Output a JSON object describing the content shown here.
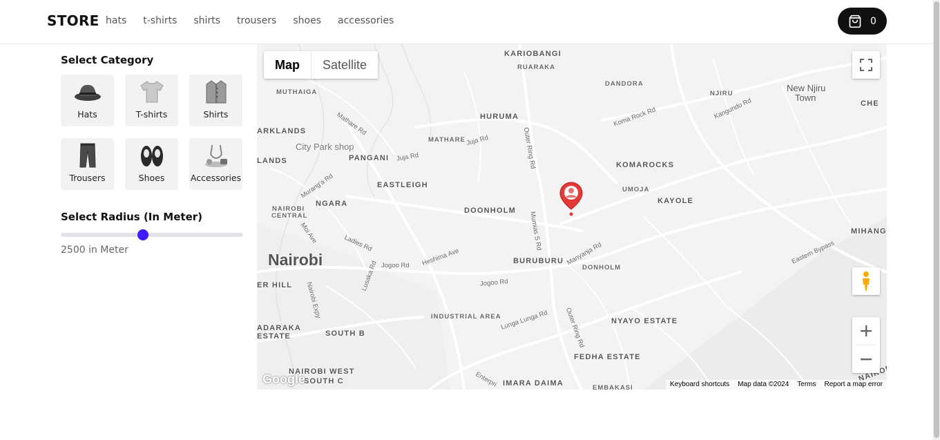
{
  "header": {
    "brand": "STORE",
    "nav": [
      "hats",
      "t-shirts",
      "shirts",
      "trousers",
      "shoes",
      "accessories"
    ],
    "cart_count": "0"
  },
  "sidebar": {
    "category_title": "Select Category",
    "categories": [
      {
        "label": "Hats",
        "icon": "hat-icon"
      },
      {
        "label": "T-shirts",
        "icon": "tshirt-icon"
      },
      {
        "label": "Shirts",
        "icon": "shirt-icon"
      },
      {
        "label": "Trousers",
        "icon": "trousers-icon"
      },
      {
        "label": "Shoes",
        "icon": "shoes-icon"
      },
      {
        "label": "Accessories",
        "icon": "accessories-icon"
      }
    ],
    "radius_title": "Select Radius (In Meter)",
    "radius_fraction": 0.45,
    "radius_text": "2500 in Meter",
    "accent": "#3d1bff"
  },
  "map": {
    "type_map": "Map",
    "type_satellite": "Satellite",
    "logo": "Google",
    "footer": [
      "Keyboard shortcuts",
      "Map data ©2024",
      "Terms",
      "Report a map error"
    ],
    "labels": {
      "kariobangi": "KARIOBANGI",
      "ruaraka": "RUARAKA",
      "dandora": "DANDORA",
      "njiru": "NJIRU",
      "new_njiru": "New Njiru",
      "town": "Town",
      "che": "CHE",
      "muthaiga": "MUTHAIGA",
      "huruma": "HURUMA",
      "mathare": "MATHARE",
      "parklands": "ARKLANDS",
      "city_park": "City Park shop",
      "pangani": "PANGANI",
      "lands": "LANDS",
      "komarocks": "KOMAROCKS",
      "umoja": "UMOJA",
      "kayole": "KAYOLE",
      "eastleigh": "EASTLEIGH",
      "ngara": "NGARA",
      "doonholm": "DOONHOLM",
      "nairobi_central_1": "NAIROBI",
      "nairobi_central_2": "CENTRAL",
      "mihang": "MIHANG",
      "nairobi": "Nairobi",
      "buruburu": "BURUBURU",
      "donholm": "DONHOLM",
      "hill": "ER HILL",
      "industrial": "INDUSTRIAL AREA",
      "nyayo": "NYAYO ESTATE",
      "dadaraka": "ADARAKA",
      "estate": "ESTATE",
      "south_b": "SOUTH B",
      "fedha": "FEDHA ESTATE",
      "nairobi_west": "NAIROBI WEST",
      "south_c": "SOUTH C",
      "imara": "IMARA DAIMA",
      "embakasi": "EMBAKASI",
      "nairobi_r": "NAIROBI",
      "mathare_rd": "Mathare Rd",
      "juja_rd": "Juja Rd",
      "juja_rd2": "Juja Rd",
      "outer_ring": "Outer Ring Rd",
      "outer_ring2": "Outer Ring Rd",
      "koma_rock": "Koma Rock Rd",
      "kangundo": "Kangundo Rd",
      "muranga": "Murang'a Rd",
      "moi_ave": "Moi Ave",
      "ladies": "Ladies Rd",
      "heshima": "Heshima Ave",
      "jogoo": "Jogoo Rd",
      "jogoo2": "Jogoo Rd",
      "mumias": "Mumias S Rd",
      "manyanja": "Manyanja Rd",
      "eastern_bypass": "Eastern Bypass",
      "lusaka": "Lusaka Rd",
      "nairobi_expy": "Nairobi Expy",
      "lunga": "Lunga Lunga Rd",
      "enterprise": "Enterpri"
    }
  }
}
